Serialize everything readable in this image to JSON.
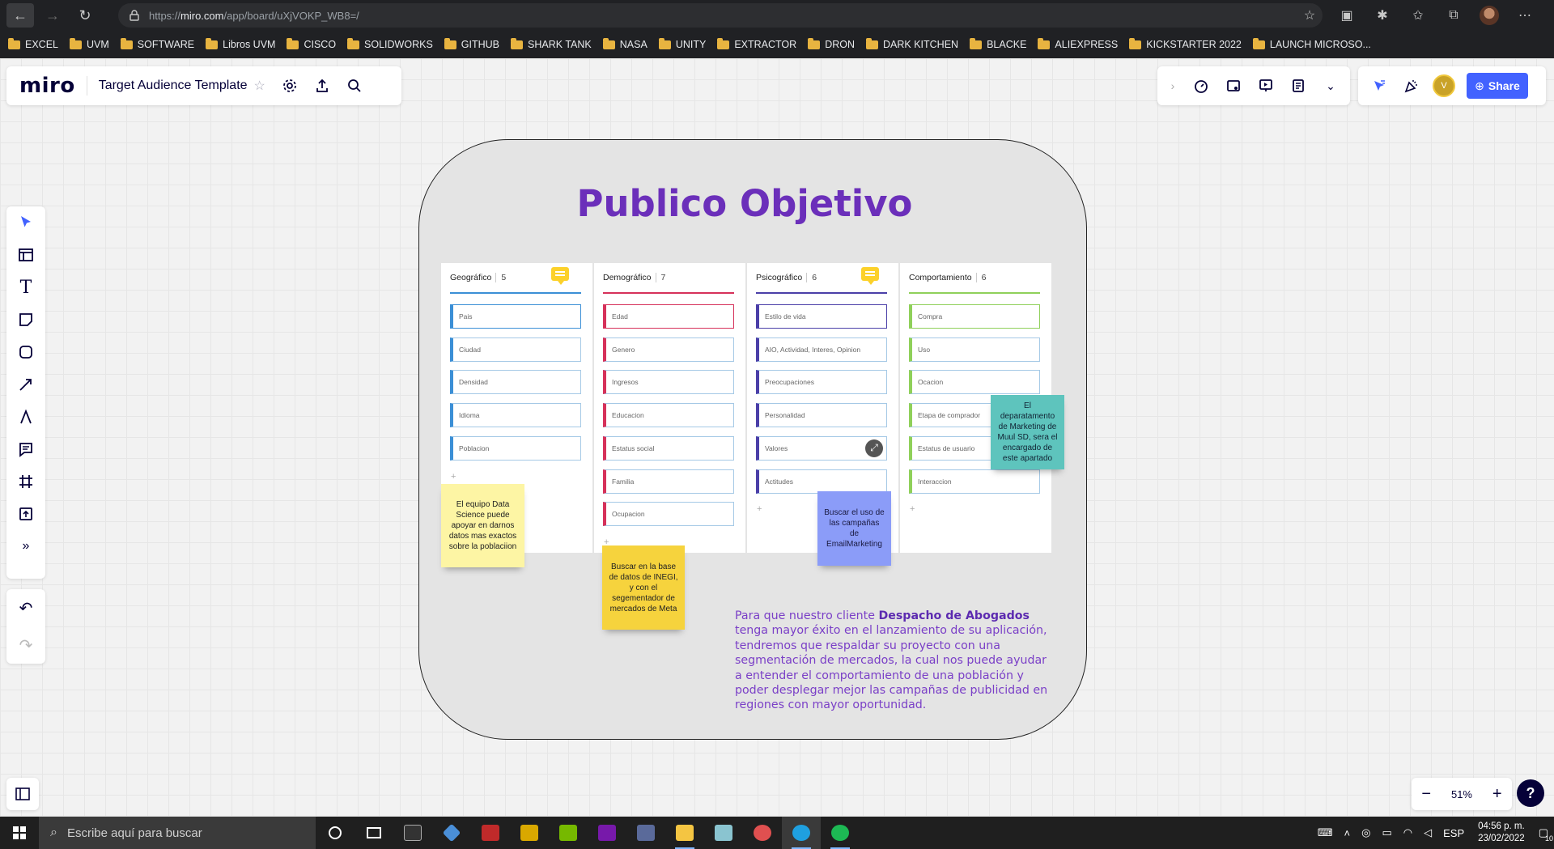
{
  "browser": {
    "url_prefix": "https://",
    "url_host": "miro.com",
    "url_path": "/app/board/uXjVOKP_WB8=/",
    "back_icon": "←",
    "forward_icon": "→",
    "reload_icon": "↻",
    "lock_icon": "🔒"
  },
  "bookmarks": [
    "EXCEL",
    "UVM",
    "SOFTWARE",
    "Libros UVM",
    "CISCO",
    "SOLIDWORKS",
    "GITHUB",
    "SHARK TANK",
    "NASA",
    "UNITY",
    "EXTRACTOR",
    "DRON",
    "DARK KITCHEN",
    "BLACKE",
    "ALIEXPRESS",
    "KICKSTARTER 2022",
    "LAUNCH MICROSO..."
  ],
  "miro": {
    "logo": "miro",
    "board_title": "Target Audience Template",
    "share_label": "Share",
    "avatar_initial": "V",
    "zoom_level": "51%",
    "help": "?"
  },
  "board": {
    "title": "Publico Objetivo",
    "columns": [
      {
        "name": "Geográfico",
        "count": "5",
        "color": "#3b8fd6",
        "cards": [
          "Pais",
          "Ciudad",
          "Densidad",
          "Idioma",
          "Poblacion"
        ]
      },
      {
        "name": "Demográfico",
        "count": "7",
        "color": "#d6315a",
        "cards": [
          "Edad",
          "Genero",
          "Ingresos",
          "Educacion",
          "Estatus social",
          "Familia",
          "Ocupacion"
        ]
      },
      {
        "name": "Psicográfico",
        "count": "6",
        "color": "#4b3fa8",
        "cards": [
          "Estilo de vida",
          "AIO, Actividad, Interes, Opinion",
          "Preocupaciones",
          "Personalidad",
          "Valores",
          "Actitudes"
        ]
      },
      {
        "name": "Comportamiento",
        "count": "6",
        "color": "#8fd05a",
        "cards": [
          "Compra",
          "Uso",
          "Ocacion",
          "Etapa de comprador",
          "Estatus de usuario",
          "Interaccion"
        ]
      }
    ],
    "stickies": {
      "data_science": "El equipo Data Science puede apoyar en darnos datos mas exactos sobre la poblaciion",
      "inegi": "Buscar en la base de datos de INEGI, y con el segementador de mercados de Meta",
      "email": "Buscar el uso de las campañas de EmailMarketing",
      "marketing": "El deparatamento de Marketing de Muul SD, sera el encargado de este apartado"
    },
    "paragraph_lead": "Para que nuestro cliente ",
    "paragraph_bold": "Despacho de Abogados",
    "paragraph_rest": " tenga mayor éxito en el lanzamiento de su aplicación, tendremos que respaldar su proyecto con una segmentación de mercados, la cual nos puede ayudar a entender el comportamiento de una población y poder desplegar mejor las campañas de publicidad en regiones con mayor oportunidad."
  },
  "taskbar": {
    "search_placeholder": "Escribe aquí para buscar",
    "language": "ESP",
    "time": "04:56 p. m.",
    "date": "23/02/2022",
    "notifications": "10"
  },
  "colors": {
    "title_purple": "#6b2fba",
    "miro_blue": "#4262ff",
    "sticky_yellow": "#fdf5a4",
    "sticky_orange": "#f6d33d",
    "sticky_blue": "#8b9cf8",
    "sticky_teal": "#5ec4bd"
  }
}
